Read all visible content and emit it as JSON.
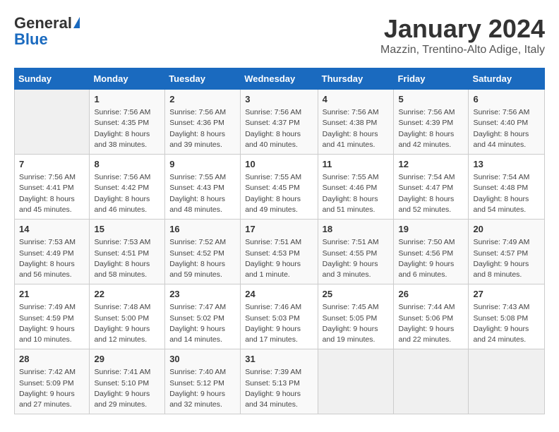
{
  "logo": {
    "line1": "General",
    "line2": "Blue"
  },
  "calendar": {
    "title": "January 2024",
    "subtitle": "Mazzin, Trentino-Alto Adige, Italy"
  },
  "weekdays": [
    "Sunday",
    "Monday",
    "Tuesday",
    "Wednesday",
    "Thursday",
    "Friday",
    "Saturday"
  ],
  "weeks": [
    [
      {
        "day": "",
        "info": ""
      },
      {
        "day": "1",
        "info": "Sunrise: 7:56 AM\nSunset: 4:35 PM\nDaylight: 8 hours\nand 38 minutes."
      },
      {
        "day": "2",
        "info": "Sunrise: 7:56 AM\nSunset: 4:36 PM\nDaylight: 8 hours\nand 39 minutes."
      },
      {
        "day": "3",
        "info": "Sunrise: 7:56 AM\nSunset: 4:37 PM\nDaylight: 8 hours\nand 40 minutes."
      },
      {
        "day": "4",
        "info": "Sunrise: 7:56 AM\nSunset: 4:38 PM\nDaylight: 8 hours\nand 41 minutes."
      },
      {
        "day": "5",
        "info": "Sunrise: 7:56 AM\nSunset: 4:39 PM\nDaylight: 8 hours\nand 42 minutes."
      },
      {
        "day": "6",
        "info": "Sunrise: 7:56 AM\nSunset: 4:40 PM\nDaylight: 8 hours\nand 44 minutes."
      }
    ],
    [
      {
        "day": "7",
        "info": "Sunrise: 7:56 AM\nSunset: 4:41 PM\nDaylight: 8 hours\nand 45 minutes."
      },
      {
        "day": "8",
        "info": "Sunrise: 7:56 AM\nSunset: 4:42 PM\nDaylight: 8 hours\nand 46 minutes."
      },
      {
        "day": "9",
        "info": "Sunrise: 7:55 AM\nSunset: 4:43 PM\nDaylight: 8 hours\nand 48 minutes."
      },
      {
        "day": "10",
        "info": "Sunrise: 7:55 AM\nSunset: 4:45 PM\nDaylight: 8 hours\nand 49 minutes."
      },
      {
        "day": "11",
        "info": "Sunrise: 7:55 AM\nSunset: 4:46 PM\nDaylight: 8 hours\nand 51 minutes."
      },
      {
        "day": "12",
        "info": "Sunrise: 7:54 AM\nSunset: 4:47 PM\nDaylight: 8 hours\nand 52 minutes."
      },
      {
        "day": "13",
        "info": "Sunrise: 7:54 AM\nSunset: 4:48 PM\nDaylight: 8 hours\nand 54 minutes."
      }
    ],
    [
      {
        "day": "14",
        "info": "Sunrise: 7:53 AM\nSunset: 4:49 PM\nDaylight: 8 hours\nand 56 minutes."
      },
      {
        "day": "15",
        "info": "Sunrise: 7:53 AM\nSunset: 4:51 PM\nDaylight: 8 hours\nand 58 minutes."
      },
      {
        "day": "16",
        "info": "Sunrise: 7:52 AM\nSunset: 4:52 PM\nDaylight: 8 hours\nand 59 minutes."
      },
      {
        "day": "17",
        "info": "Sunrise: 7:51 AM\nSunset: 4:53 PM\nDaylight: 9 hours\nand 1 minute."
      },
      {
        "day": "18",
        "info": "Sunrise: 7:51 AM\nSunset: 4:55 PM\nDaylight: 9 hours\nand 3 minutes."
      },
      {
        "day": "19",
        "info": "Sunrise: 7:50 AM\nSunset: 4:56 PM\nDaylight: 9 hours\nand 6 minutes."
      },
      {
        "day": "20",
        "info": "Sunrise: 7:49 AM\nSunset: 4:57 PM\nDaylight: 9 hours\nand 8 minutes."
      }
    ],
    [
      {
        "day": "21",
        "info": "Sunrise: 7:49 AM\nSunset: 4:59 PM\nDaylight: 9 hours\nand 10 minutes."
      },
      {
        "day": "22",
        "info": "Sunrise: 7:48 AM\nSunset: 5:00 PM\nDaylight: 9 hours\nand 12 minutes."
      },
      {
        "day": "23",
        "info": "Sunrise: 7:47 AM\nSunset: 5:02 PM\nDaylight: 9 hours\nand 14 minutes."
      },
      {
        "day": "24",
        "info": "Sunrise: 7:46 AM\nSunset: 5:03 PM\nDaylight: 9 hours\nand 17 minutes."
      },
      {
        "day": "25",
        "info": "Sunrise: 7:45 AM\nSunset: 5:05 PM\nDaylight: 9 hours\nand 19 minutes."
      },
      {
        "day": "26",
        "info": "Sunrise: 7:44 AM\nSunset: 5:06 PM\nDaylight: 9 hours\nand 22 minutes."
      },
      {
        "day": "27",
        "info": "Sunrise: 7:43 AM\nSunset: 5:08 PM\nDaylight: 9 hours\nand 24 minutes."
      }
    ],
    [
      {
        "day": "28",
        "info": "Sunrise: 7:42 AM\nSunset: 5:09 PM\nDaylight: 9 hours\nand 27 minutes."
      },
      {
        "day": "29",
        "info": "Sunrise: 7:41 AM\nSunset: 5:10 PM\nDaylight: 9 hours\nand 29 minutes."
      },
      {
        "day": "30",
        "info": "Sunrise: 7:40 AM\nSunset: 5:12 PM\nDaylight: 9 hours\nand 32 minutes."
      },
      {
        "day": "31",
        "info": "Sunrise: 7:39 AM\nSunset: 5:13 PM\nDaylight: 9 hours\nand 34 minutes."
      },
      {
        "day": "",
        "info": ""
      },
      {
        "day": "",
        "info": ""
      },
      {
        "day": "",
        "info": ""
      }
    ]
  ]
}
